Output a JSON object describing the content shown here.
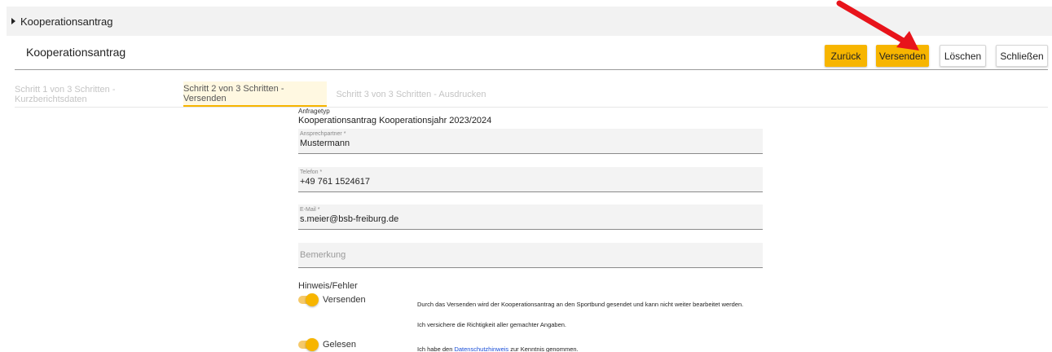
{
  "topbar": {
    "label": "Kooperationsantrag"
  },
  "header": {
    "title": "Kooperationsantrag",
    "buttons": {
      "back": "Zurück",
      "send": "Versenden",
      "delete": "Löschen",
      "close": "Schließen"
    }
  },
  "steps": [
    {
      "label": "Schritt 1 von 3 Schritten - Kurzberichtsdaten",
      "active": false
    },
    {
      "label": "Schritt 2 von 3 Schritten - Versenden",
      "active": true
    },
    {
      "label": "Schritt 3 von 3 Schritten - Ausdrucken",
      "active": false
    }
  ],
  "form": {
    "anfragetyp": {
      "label": "Anfragetyp",
      "value": "Kooperationsantrag Kooperationsjahr 2023/2024"
    },
    "ansprechpartner": {
      "label": "Ansprechpartner *",
      "value": "Mustermann"
    },
    "telefon": {
      "label": "Telefon *",
      "value": "+49 761 1524617"
    },
    "email": {
      "label": "E-Mail *",
      "value": "s.meier@bsb-freiburg.de"
    },
    "bemerkung": {
      "placeholder": "Bemerkung"
    }
  },
  "hinweis": {
    "title": "Hinweis/Fehler",
    "versenden": {
      "label": "Versenden",
      "checked": true,
      "text1": "Durch das Versenden wird der Kooperationsantrag an den Sportbund gesendet und kann nicht weiter bearbeitet werden.",
      "text2": "Ich versichere die Richtigkeit aller gemachter Angaben."
    },
    "gelesen": {
      "label": "Gelesen",
      "checked": true,
      "text_before": "Ich habe den ",
      "link": "Datenschutzhinweis",
      "text_after": " zur Kenntnis genommen."
    }
  },
  "colors": {
    "accent": "#f7b500",
    "annotation_arrow": "#e8141b",
    "link": "#1a4fd8"
  }
}
